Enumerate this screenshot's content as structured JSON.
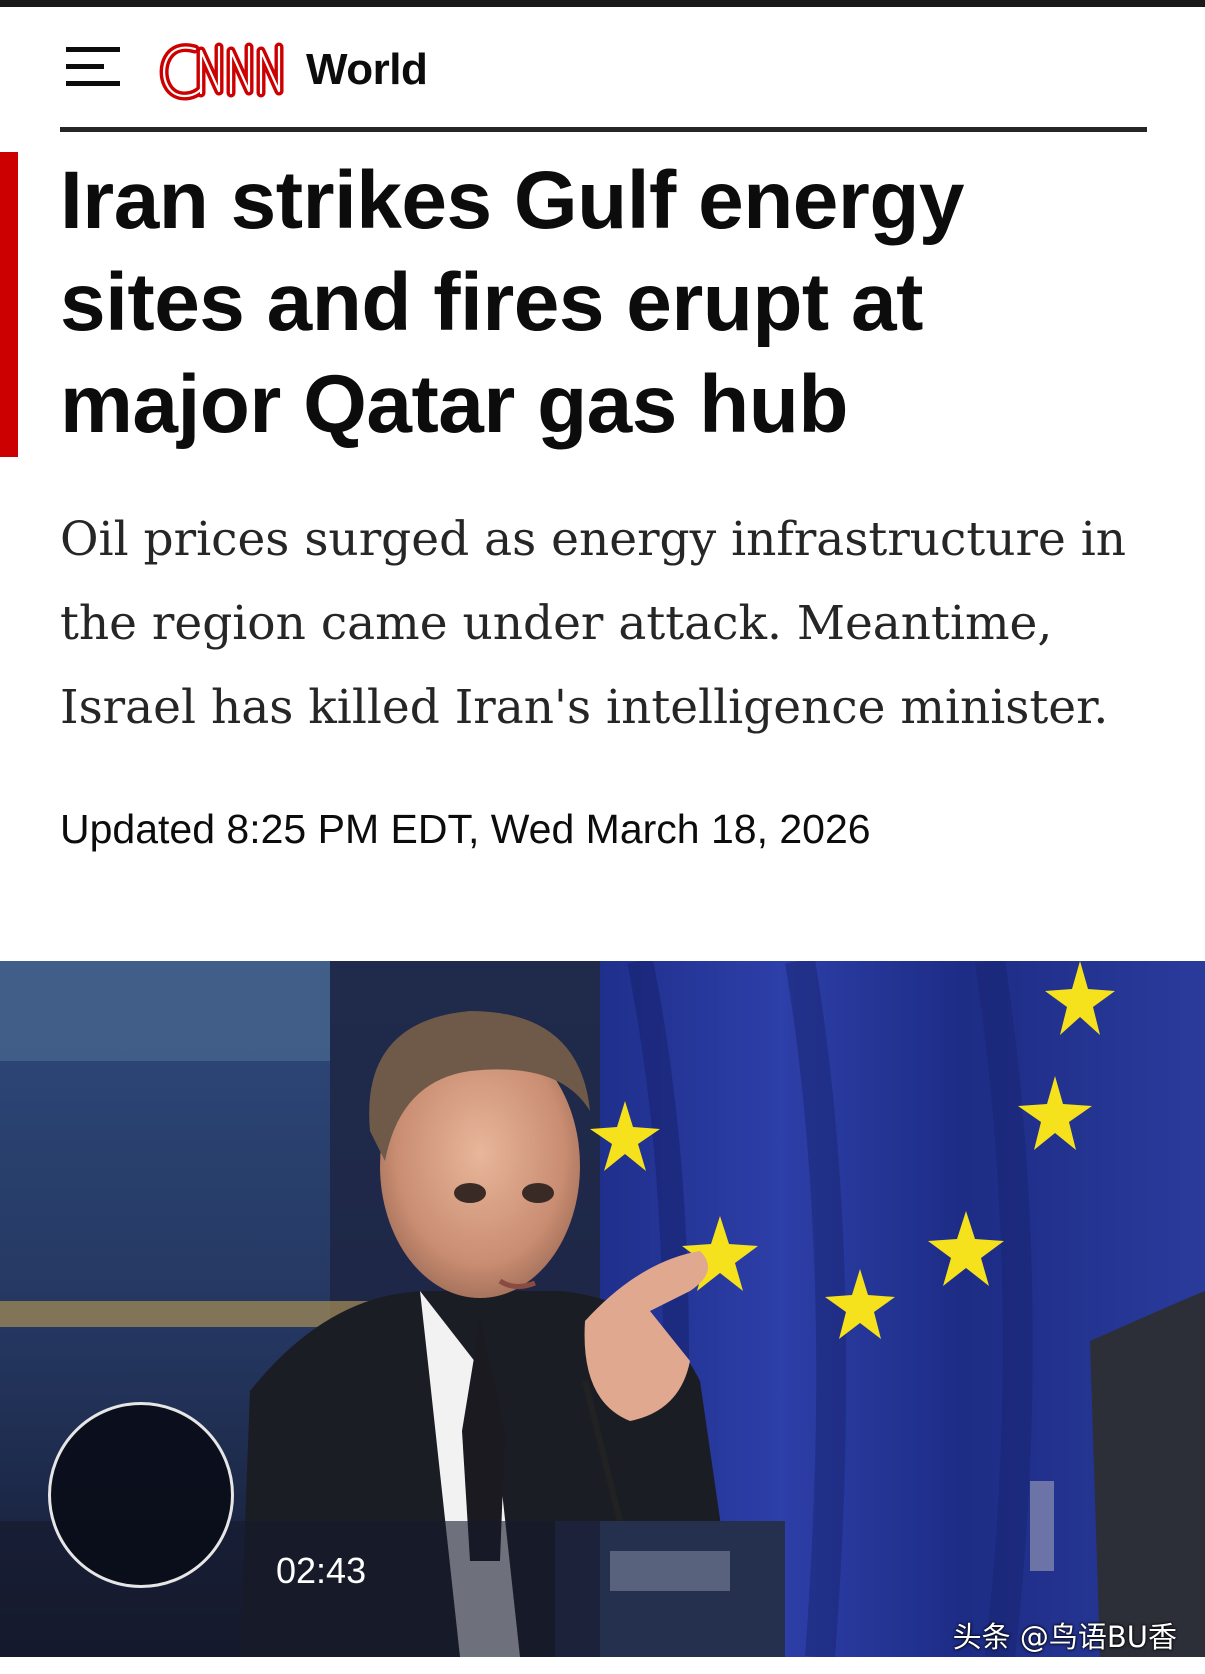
{
  "header": {
    "menu_icon": "hamburger-menu-icon",
    "logo_text": "CNN",
    "logo_color": "#cc0000",
    "section": "World"
  },
  "article": {
    "headline": "Iran strikes Gulf energy sites and fires erupt at major Qatar gas hub",
    "dek": "Oil prices surged as energy infrastructure in the region came under attack. Meantime, Israel has killed Iran's intelligence minister.",
    "timestamp": "Updated 8:25 PM EDT, Wed March 18, 2026",
    "accent_color": "#cc0000"
  },
  "video": {
    "duration": "02:43",
    "play_icon": "play-circle-icon"
  },
  "watermark": "头条 @鸟语BU香"
}
